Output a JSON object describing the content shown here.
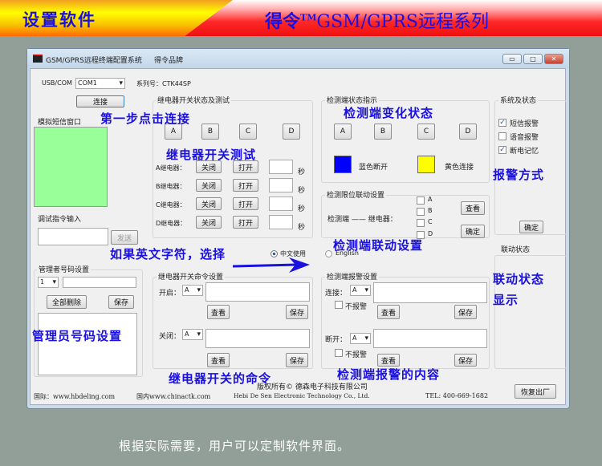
{
  "banner": {
    "left_title": "设置软件",
    "brand": "得令",
    "tm": "TM",
    "series": "GSM/GPRS远程系列"
  },
  "window": {
    "title": "GSM/GPRS远程终端配置系统",
    "brand": "得令品牌",
    "min": "▭",
    "max": "□",
    "close": "✕"
  },
  "conn": {
    "port_label": "USB/COM",
    "port_value": "COM1",
    "serial_label": "系列号：CTK44SP",
    "connect": "连接"
  },
  "sms": {
    "label": "模拟短信窗口",
    "color": "#99ff99"
  },
  "debug": {
    "label": "调试指令输入",
    "send": "发送"
  },
  "relay_test": {
    "title": "继电器开关状态及测试",
    "channels": [
      "A",
      "B",
      "C",
      "D"
    ],
    "rows": [
      {
        "label": "A继电器：",
        "off": "关闭",
        "on": "打开",
        "unit": "秒"
      },
      {
        "label": "B继电器：",
        "off": "关闭",
        "on": "打开",
        "unit": "秒"
      },
      {
        "label": "C继电器：",
        "off": "关闭",
        "on": "打开",
        "unit": "秒"
      },
      {
        "label": "D继电器：",
        "off": "关闭",
        "on": "打开",
        "unit": "秒"
      }
    ]
  },
  "detect_status": {
    "title": "检测端状态指示",
    "channels": [
      "A",
      "B",
      "C",
      "D"
    ],
    "blue_label": "蓝色断开",
    "blue": "#0000ff",
    "yellow_label": "黄色连接",
    "yellow": "#ffff00"
  },
  "linkage": {
    "title": "检测限位联动设置",
    "text": "检测端 —— 继电器：",
    "options": [
      "A",
      "B",
      "C",
      "D"
    ],
    "view": "查看",
    "ok": "确定"
  },
  "system": {
    "title": "系统及状态",
    "options": [
      {
        "label": "短信报警",
        "checked": true
      },
      {
        "label": "语音报警",
        "checked": false
      },
      {
        "label": "断电记忆",
        "checked": true
      }
    ],
    "ok": "确定"
  },
  "link_status": {
    "title": "联动状态"
  },
  "language": {
    "options": [
      {
        "label": "中文使用",
        "selected": true
      },
      {
        "label": "English",
        "selected": false
      }
    ]
  },
  "admin": {
    "title": "管理者号码设置",
    "index": "1",
    "delete_all": "全部删除",
    "save": "保存"
  },
  "relay_cmd": {
    "title": "继电器开关命令设置",
    "open_label": "开启：",
    "close_label": "关闭：",
    "channel": "A",
    "view": "查看",
    "save": "保存"
  },
  "alarm": {
    "title": "检测端报警设置",
    "connect_label": "连接：",
    "disconnect_label": "断开：",
    "channel": "A",
    "no_alarm": "不报警",
    "view": "查看",
    "save": "保存"
  },
  "footer": {
    "copyright": "版权所有© 德森电子科技有限公司",
    "intl": "国际：www.hbdeling.com",
    "domestic": "国内www.chinactk.com",
    "company_en": "Hebi De Sen Electronic Technology Co., Ltd.",
    "tel": "TEL: 400-669-1682",
    "reset": "恢复出厂"
  },
  "annotations": {
    "step1": "第一步点击连接",
    "detect_change": "检测端变化状态",
    "relay_test": "继电器开关测试",
    "alarm_mode": "报警方式",
    "english": "如果英文字符，选择",
    "linkage": "检测端联动设置",
    "link_status1": "联动状态",
    "link_status2": "显示",
    "admin": "管理员号码设置",
    "relay_cmd": "继电器开关的命令",
    "alarm_content": "检测端报警的内容"
  },
  "caption": "根据实际需要，用户可以定制软件界面。"
}
